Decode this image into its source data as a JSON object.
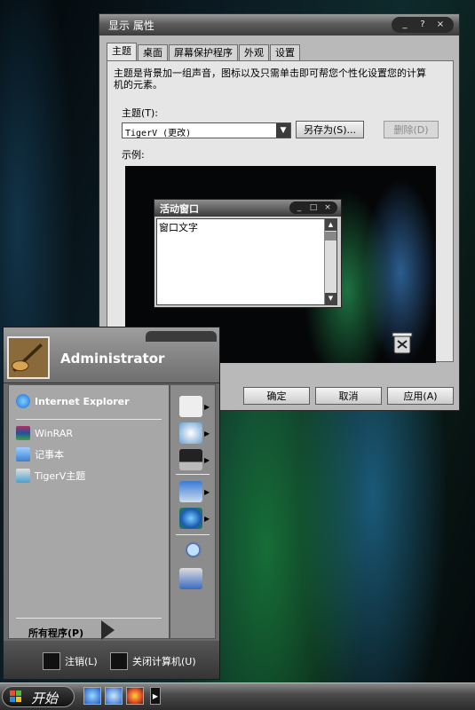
{
  "dialog": {
    "title": "显示 属性",
    "caption_buttons": [
      "_",
      "?",
      "×"
    ],
    "tabs": [
      "主题",
      "桌面",
      "屏幕保护程序",
      "外观",
      "设置"
    ],
    "active_tab": "主题",
    "description": "主题是背景加一组声音，图标以及只需单击即可帮您个性化设置您的计算机的元素。",
    "theme_label": "主题(T):",
    "theme_value": "TigerV (更改)",
    "save_as": "另存为(S)...",
    "delete": "删除(D)",
    "example_label": "示例:",
    "preview_window": {
      "title": "活动窗口",
      "caption_buttons": [
        "_",
        "□",
        "×"
      ],
      "body_text": "窗口文字"
    },
    "ok": "确定",
    "cancel": "取消",
    "apply": "应用(A)"
  },
  "start_menu": {
    "user": "Administrator",
    "pinned": [
      {
        "label": "Internet Explorer",
        "icon": "internet-explorer-icon"
      }
    ],
    "recent": [
      {
        "label": "WinRAR",
        "icon": "winrar-icon"
      },
      {
        "label": "记事本",
        "icon": "notepad-icon"
      },
      {
        "label": "TigerV主题",
        "icon": "theme-icon"
      }
    ],
    "right_icons": [
      "documents-icon",
      "clock-icon",
      "computer-icon",
      "control-panel-icon",
      "network-globe-icon",
      "search-icon",
      "run-icon"
    ],
    "all_programs": "所有程序(P)",
    "logoff": "注销(L)",
    "shutdown": "关闭计算机(U)"
  },
  "taskbar": {
    "start_label": "开始",
    "quick_launch": [
      "internet-explorer-icon",
      "ie-alt-icon",
      "media-player-icon"
    ]
  }
}
